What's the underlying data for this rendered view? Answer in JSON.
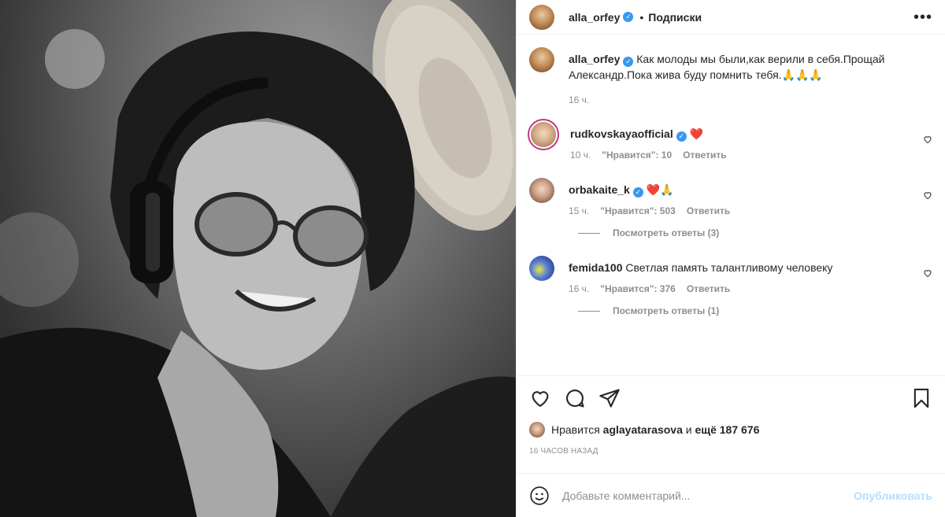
{
  "header": {
    "username": "alla_orfey",
    "separator": "•",
    "follow_label": "Подписки",
    "more_label": "•••"
  },
  "caption": {
    "username": "alla_orfey",
    "text": "Как молоды мы были,как верили в себя.Прощай Александр.Пока жива буду помнить тебя.🙏🙏🙏",
    "time": "16 ч."
  },
  "comments": [
    {
      "username": "rudkovskayaofficial",
      "verified": true,
      "text": "❤️",
      "time": "10 ч.",
      "likes": "\"Нравится\": 10",
      "reply": "Ответить",
      "view_replies": ""
    },
    {
      "username": "orbakaite_k",
      "verified": true,
      "text": "❤️🙏",
      "time": "15 ч.",
      "likes": "\"Нравится\": 503",
      "reply": "Ответить",
      "view_replies": "Посмотреть ответы (3)"
    },
    {
      "username": "femida100",
      "verified": false,
      "text": "Светлая память талантливому человеку",
      "time": "16 ч.",
      "likes": "\"Нравится\": 376",
      "reply": "Ответить",
      "view_replies": "Посмотреть ответы (1)"
    }
  ],
  "likes": {
    "prefix": "Нравится",
    "user": "aglayatarasova",
    "middle": "и",
    "count": "ещё 187 676"
  },
  "timeago": "16 ЧАСОВ НАЗАД",
  "add_comment": {
    "placeholder": "Добавьте комментарий...",
    "publish_label": "Опубликовать"
  },
  "icons": {
    "like": "heart-icon",
    "comment": "comment-icon",
    "share": "share-icon",
    "save": "bookmark-icon",
    "emoji": "emoji-icon",
    "verified": "verified-badge-icon"
  },
  "colors": {
    "verified": "#3897f0",
    "heart_red": "#ed4956",
    "publish_disabled": "#b2dffc",
    "muted": "#8e8e8e"
  }
}
